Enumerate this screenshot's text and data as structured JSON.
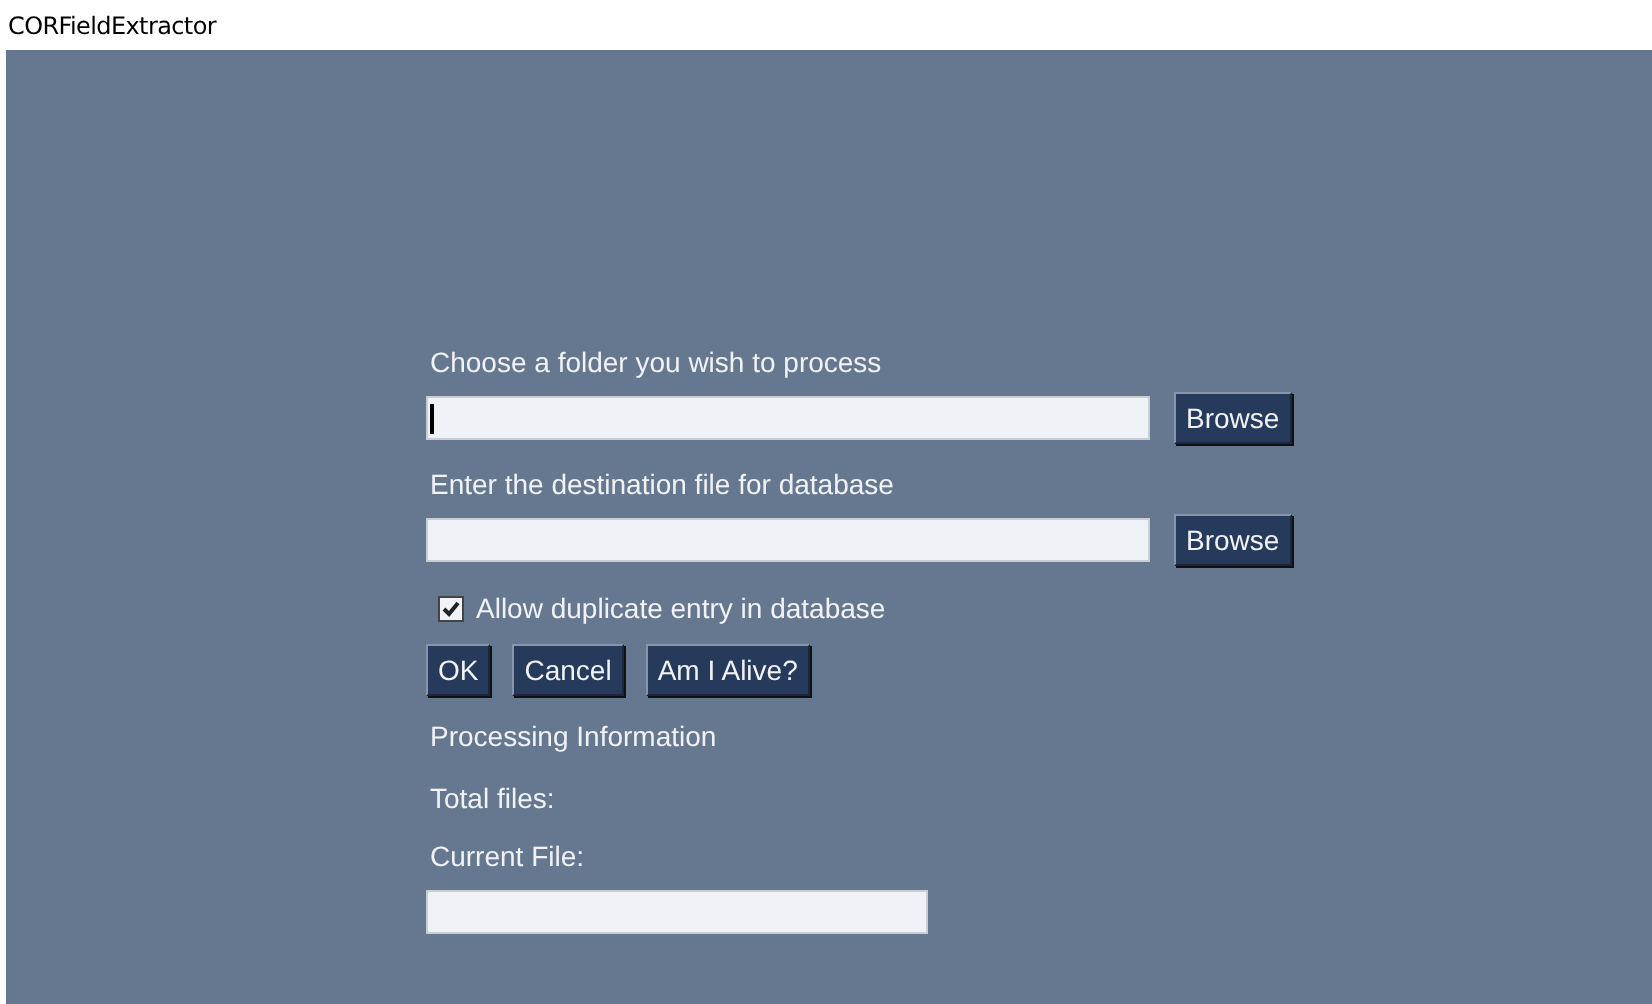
{
  "window": {
    "title": "CORFieldExtractor"
  },
  "source": {
    "label": "Choose a folder you wish to process",
    "focused": true,
    "button": "Browse"
  },
  "destination": {
    "label": "Enter the destination file for database",
    "focused": false,
    "button": "Browse"
  },
  "allow_duplicates": {
    "label": "Allow duplicate entry in database",
    "checked": true
  },
  "buttons": [
    "OK",
    "Cancel",
    "Am I Alive?"
  ],
  "processing": {
    "heading": "Processing Information",
    "total_files_label": "Total files:",
    "current_file_label": "Current File:"
  }
}
